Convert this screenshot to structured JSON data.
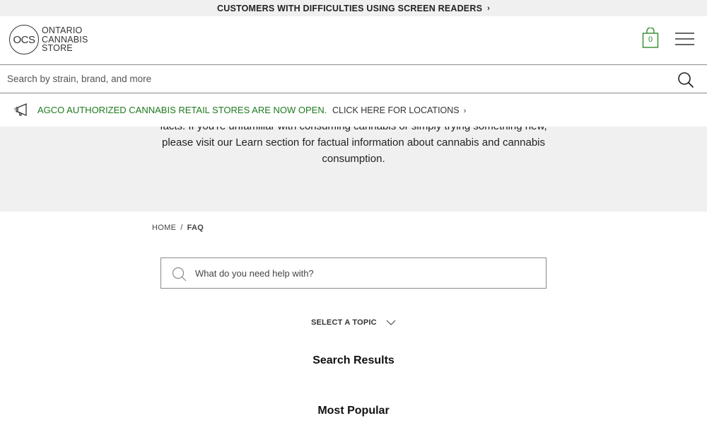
{
  "top_banner": {
    "text": "CUSTOMERS WITH DIFFICULTIES USING SCREEN READERS",
    "chevron": "›"
  },
  "header": {
    "logo": {
      "monogram": "OCS",
      "line1": "ONTARIO",
      "line2": "CANNABIS",
      "line3": "STORE"
    },
    "cart_count": "0",
    "cart_icon": "shopping-bag-icon",
    "menu_icon": "hamburger-menu-icon",
    "accent_color": "#2e8b2e"
  },
  "site_search": {
    "placeholder": "Search by strain, brand, and more",
    "icon": "search-icon"
  },
  "announcement": {
    "icon": "megaphone-icon",
    "highlight": "AGCO AUTHORIZED CANNABIS RETAIL STORES ARE NOW OPEN.",
    "link": "CLICK HERE FOR LOCATIONS",
    "highlight_color": "#1e7a1e"
  },
  "intro": {
    "text": "facts. If you're unfamiliar with consuming cannabis or simply trying something new, please visit our Learn section for factual information about cannabis and cannabis consumption."
  },
  "breadcrumb": {
    "home": "HOME",
    "separator": "/",
    "current": "FAQ"
  },
  "help_search": {
    "placeholder": "What do you need help with?"
  },
  "topic_select": {
    "label": "SELECT A TOPIC"
  },
  "sections": {
    "results": "Search Results",
    "popular": "Most Popular"
  }
}
